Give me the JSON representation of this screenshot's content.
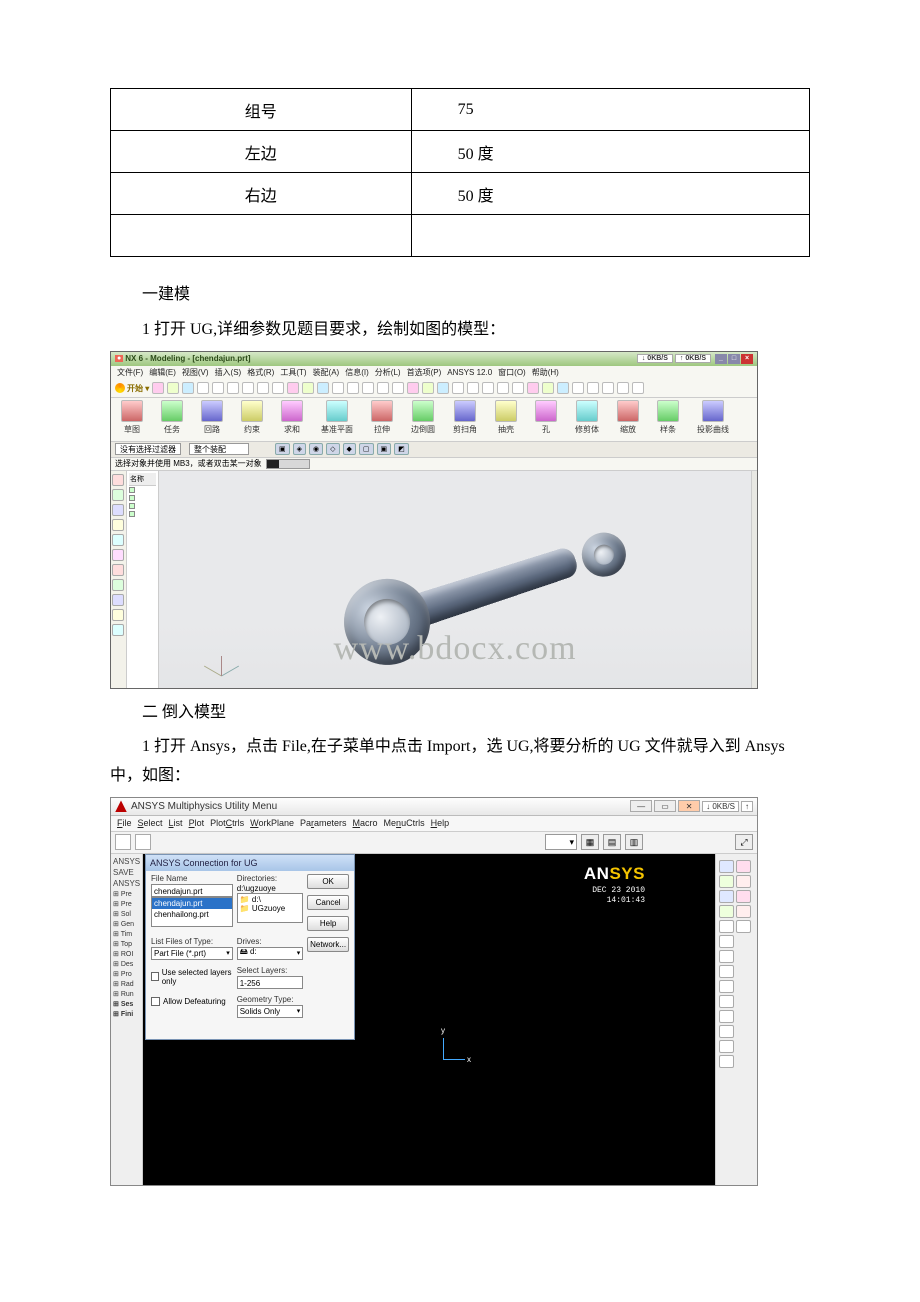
{
  "table": {
    "rows": [
      {
        "label": "组号",
        "value": "75"
      },
      {
        "label": "左边",
        "value": "50 度"
      },
      {
        "label": "右边",
        "value": "50 度"
      },
      {
        "label": "",
        "value": ""
      }
    ]
  },
  "section1": {
    "heading": "一建模",
    "para1": "1 打开 UG,详细参数见题目要求，绘制如图的模型："
  },
  "section2": {
    "heading": "二 倒入模型",
    "para1": "1 打开 Ansys，点击 File,在子菜单中点击 Import，选 UG,将要分析的 UG 文件就导入到 Ansys 中，如图："
  },
  "nx": {
    "app": "NX 6",
    "mode": "Modeling",
    "doc": "[chendajun.prt]",
    "status_rate": "0KB/S",
    "menubar": [
      "文件(F)",
      "编辑(E)",
      "视图(V)",
      "插入(S)",
      "格式(R)",
      "工具(T)",
      "装配(A)",
      "信息(I)",
      "分析(L)",
      "首选项(P)",
      "ANSYS 12.0",
      "窗口(O)",
      "帮助(H)"
    ],
    "start_label": "开始 ▾",
    "big_tools": [
      "草图",
      "任务",
      "回路",
      "约束",
      "求和",
      "基准平面",
      "拉伸",
      "边倒圆",
      "剪扫角",
      "抽壳",
      "孔",
      "修剪体",
      "缩放",
      "样条",
      "投影曲线"
    ],
    "filter_left_label": "没有选择过滤器",
    "filter_right_label": "整个装配",
    "hint": "选择对象并使用 MB3，或者双击某一对象",
    "tree": {
      "header": "名称"
    },
    "watermark": "www.bdocx.com"
  },
  "ansys": {
    "window_title": "ANSYS Multiphysics Utility Menu",
    "status_rate": "0KB/S",
    "menu": [
      "File",
      "Select",
      "List",
      "Plot",
      "PlotCtrls",
      "WorkPlane",
      "Parameters",
      "Macro",
      "MenuCtrls",
      "Help"
    ],
    "side_hdr1": "ANSYS",
    "side_hdr2": "SAVE",
    "side_hdr3": "ANSYS",
    "tree_items": [
      "Pre",
      "Pre",
      "Sol",
      "Gen",
      "Tim",
      "Top",
      "ROI",
      "Des",
      "Pro",
      "Rad",
      "Run",
      "Ses",
      "Fini"
    ],
    "brand": "ANSYS",
    "timestamp_line1": "DEC 23 2010",
    "timestamp_line2": "14:01:43",
    "coord_x": "x",
    "coord_y": "y"
  },
  "dialog": {
    "title": "ANSYS Connection for UG",
    "file_name_label": "File Name",
    "file_name_value": "chendajun.prt",
    "file_list_sel": "chendajun.prt",
    "file_list_other": "chenhailong.prt",
    "directories_label": "Directories:",
    "directories_value": "d:\\ugzuoye",
    "dir_item1": "d:\\",
    "dir_item2": "UGzuoye",
    "type_label": "List Files of Type:",
    "type_value": "Part File (*.prt)",
    "drives_label": "Drives:",
    "drives_value": "d:",
    "chk_layers": "Use selected layers only",
    "sel_layers_label": "Select Layers:",
    "sel_layers_value": "1-256",
    "chk_defeat": "Allow Defeaturing",
    "geom_label": "Geometry Type:",
    "geom_value": "Solids Only",
    "btn_ok": "OK",
    "btn_cancel": "Cancel",
    "btn_help": "Help",
    "btn_network": "Network..."
  }
}
